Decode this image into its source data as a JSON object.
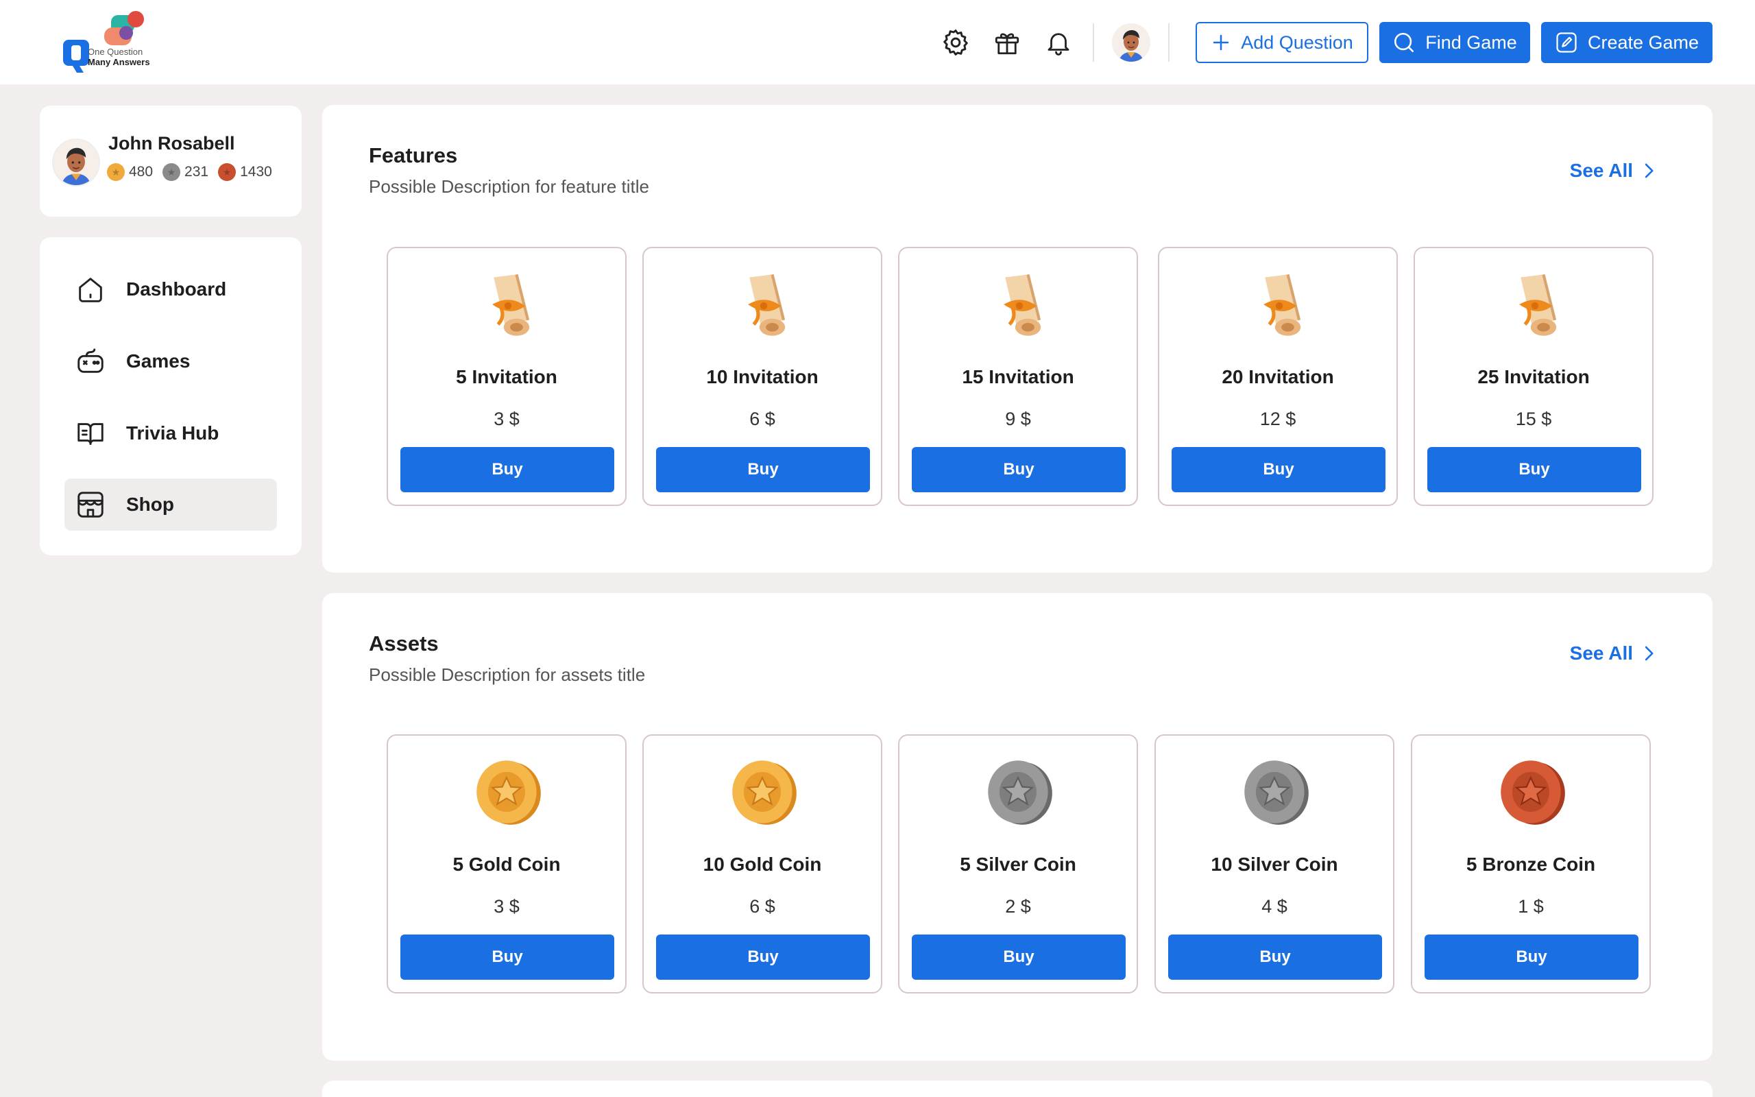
{
  "brand": {
    "line1": "One Question",
    "line2": "Many Answers",
    "colors": {
      "blue": "#1a6fe3",
      "teal": "#2bb3a3",
      "red": "#e04a3f",
      "purple": "#7b4fa3"
    }
  },
  "header": {
    "icons": [
      "gear-icon",
      "gift-icon",
      "bell-icon"
    ],
    "add_question": "Add Question",
    "find_game": "Find Game",
    "create_game": "Create Game"
  },
  "profile": {
    "name": "John Rosabell",
    "gold": "480",
    "silver": "231",
    "bronze": "1430"
  },
  "nav": {
    "items": [
      {
        "label": "Dashboard",
        "icon": "home-icon"
      },
      {
        "label": "Games",
        "icon": "gamepad-icon"
      },
      {
        "label": "Trivia Hub",
        "icon": "book-icon"
      },
      {
        "label": "Shop",
        "icon": "store-icon",
        "active": true
      }
    ]
  },
  "features": {
    "title": "Features",
    "description": "Possible Description for feature title",
    "see_all": "See All",
    "items": [
      {
        "title": "5 Invitation",
        "price": "3 $",
        "buy": "Buy",
        "art": "scroll-icon"
      },
      {
        "title": "10 Invitation",
        "price": "6 $",
        "buy": "Buy",
        "art": "scroll-icon"
      },
      {
        "title": "15 Invitation",
        "price": "9 $",
        "buy": "Buy",
        "art": "scroll-icon"
      },
      {
        "title": "20 Invitation",
        "price": "12 $",
        "buy": "Buy",
        "art": "scroll-icon"
      },
      {
        "title": "25 Invitation",
        "price": "15 $",
        "buy": "Buy",
        "art": "scroll-icon"
      }
    ]
  },
  "assets": {
    "title": "Assets",
    "description": "Possible Description for assets title",
    "see_all": "See All",
    "items": [
      {
        "title": "5 Gold Coin",
        "price": "3 $",
        "buy": "Buy",
        "art": "gold-coin-icon"
      },
      {
        "title": "10 Gold Coin",
        "price": "6 $",
        "buy": "Buy",
        "art": "gold-coin-icon"
      },
      {
        "title": "5 Silver Coin",
        "price": "2 $",
        "buy": "Buy",
        "art": "silver-coin-icon"
      },
      {
        "title": "10 Silver Coin",
        "price": "4 $",
        "buy": "Buy",
        "art": "silver-coin-icon"
      },
      {
        "title": "5 Bronze Coin",
        "price": "1 $",
        "buy": "Buy",
        "art": "bronze-coin-icon"
      }
    ]
  },
  "coin_colors": {
    "gold": "#f0a93a",
    "silver": "#8a8a8a",
    "bronze": "#c8502e"
  }
}
